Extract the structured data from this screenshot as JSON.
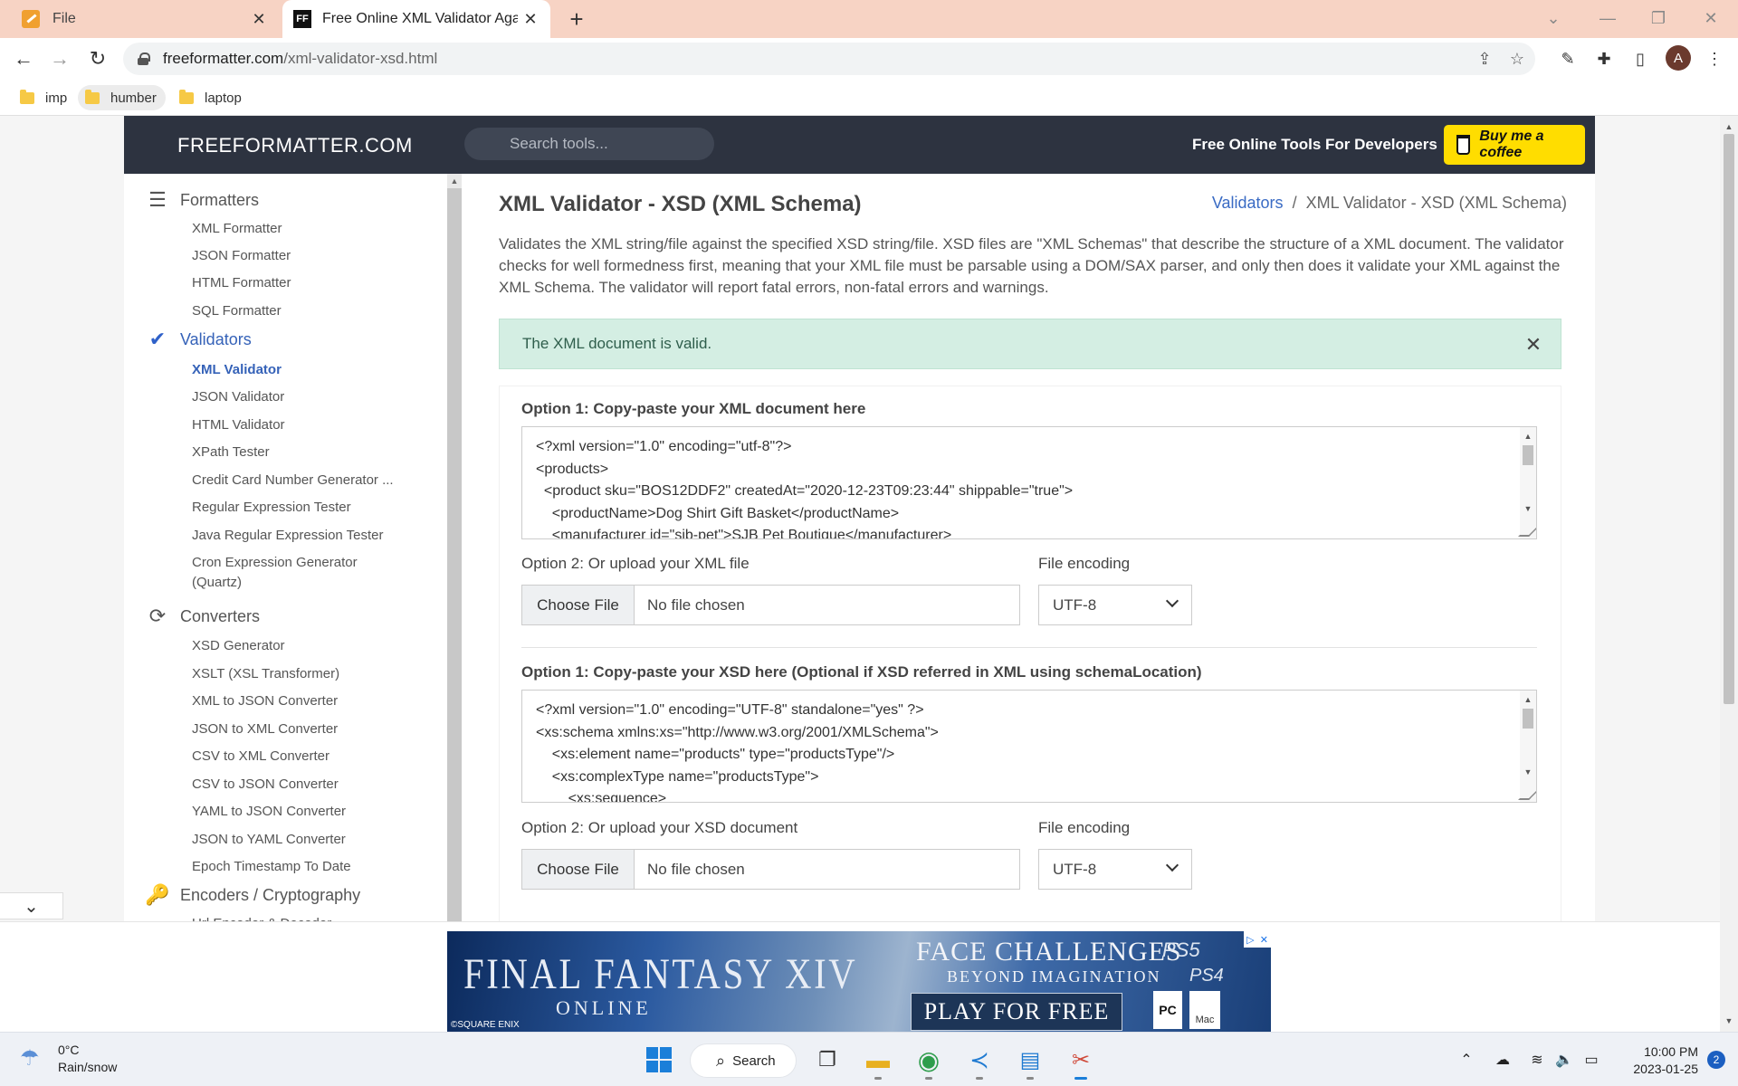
{
  "browser": {
    "tabs": [
      {
        "title": "File",
        "active": false
      },
      {
        "title": "Free Online XML Validator Against",
        "active": true
      }
    ],
    "url_host": "freeformatter.com",
    "url_path": "/xml-validator-xsd.html",
    "profile_initial": "A",
    "bookmarks": [
      "imp",
      "humber",
      "laptop"
    ]
  },
  "header": {
    "logo": "FREEFORMATTER.COM",
    "search_placeholder": "Search tools...",
    "tagline": "Free Online Tools For Developers",
    "coffee_label": "Buy me a coffee"
  },
  "sidebar": {
    "sections": [
      {
        "title": "Formatters",
        "icon": "list-indent-icon",
        "items": [
          "XML Formatter",
          "JSON Formatter",
          "HTML Formatter",
          "SQL Formatter"
        ]
      },
      {
        "title": "Validators",
        "icon": "checkmark-icon",
        "items": [
          "XML Validator",
          "JSON Validator",
          "HTML Validator",
          "XPath Tester",
          "Credit Card Number Generator ...",
          "Regular Expression Tester",
          "Java Regular Expression Tester",
          "Cron Expression Generator (Quartz)"
        ]
      },
      {
        "title": "Converters",
        "icon": "refresh-icon",
        "items": [
          "XSD Generator",
          "XSLT (XSL Transformer)",
          "XML to JSON Converter",
          "JSON to XML Converter",
          "CSV to XML Converter",
          "CSV to JSON Converter",
          "YAML to JSON Converter",
          "JSON to YAML Converter",
          "Epoch Timestamp To Date"
        ]
      },
      {
        "title": "Encoders / Cryptography",
        "icon": "key-icon",
        "items": [
          "Url Encoder & Decoder"
        ]
      }
    ],
    "active_item": "XML Validator"
  },
  "main": {
    "title": "XML Validator - XSD (XML Schema)",
    "breadcrumb": {
      "link": "Validators",
      "separator": "/",
      "current": "XML Validator - XSD (XML Schema)"
    },
    "intro": "Validates the XML string/file against the specified XSD string/file. XSD files are \"XML Schemas\" that describe the structure of a XML document. The validator checks for well formedness first, meaning that your XML file must be parsable using a DOM/SAX parser, and only then does it validate your XML against the XML Schema. The validator will report fatal errors, non-fatal errors and warnings.",
    "alert": "The XML document is valid.",
    "xml": {
      "label": "Option 1: Copy-paste your XML document here",
      "lines": [
        "<?xml version=\"1.0\" encoding=\"utf-8\"?>",
        "<products>",
        "  <product sku=\"BOS12DDF2\" createdAt=\"2020-12-23T09:23:44\" shippable=\"true\">",
        "    <productName>Dog Shirt Gift Basket</productName>",
        "    <manufacturer id=\"sjb-pet\">SJB Pet Boutique</manufacturer>"
      ],
      "upload_label": "Option 2: Or upload your XML file",
      "encoding_label": "File encoding",
      "choose_file": "Choose File",
      "no_file": "No file chosen",
      "encoding": "UTF-8"
    },
    "xsd": {
      "label": "Option 1: Copy-paste your XSD here (Optional if XSD referred in XML using schemaLocation)",
      "lines": [
        "<?xml version=\"1.0\" encoding=\"UTF-8\" standalone=\"yes\" ?>",
        "<xs:schema xmlns:xs=\"http://www.w3.org/2001/XMLSchema\">",
        "    <xs:element name=\"products\" type=\"productsType\"/>",
        "    <xs:complexType name=\"productsType\">",
        "        <xs:sequence>"
      ],
      "upload_label": "Option 2: Or upload your XSD document",
      "encoding_label": "File encoding",
      "choose_file": "Choose File",
      "no_file": "No file chosen",
      "encoding": "UTF-8"
    }
  },
  "ad": {
    "title": "FINAL FANTASY XIV",
    "subtitle": "ONLINE",
    "copyright": "©SQUARE ENIX",
    "headline": "FACE CHALLENGES",
    "subhead": "BEYOND IMAGINATION",
    "cta": "PLAY FOR FREE",
    "platform_ps": "PS5",
    "platform_ps4": "PS4",
    "platform_pc": "PC",
    "platform_mac": "Mac"
  },
  "taskbar": {
    "weather_temp": "0°C",
    "weather_desc": "Rain/snow",
    "search_label": "Search",
    "time": "10:00 PM",
    "date": "2023-01-25",
    "notifications": "2"
  }
}
